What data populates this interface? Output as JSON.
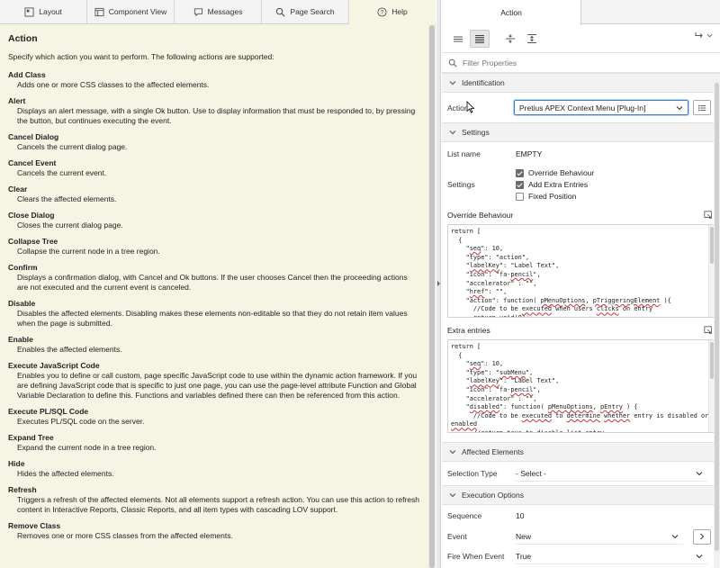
{
  "left_tabs": [
    {
      "label": "Layout",
      "icon": "layout-icon"
    },
    {
      "label": "Component View",
      "icon": "component-view-icon"
    },
    {
      "label": "Messages",
      "icon": "messages-icon"
    },
    {
      "label": "Page Search",
      "icon": "search-icon"
    },
    {
      "label": "Help",
      "icon": "help-icon"
    }
  ],
  "help": {
    "title": "Action",
    "intro": "Specify which action you want to perform. The following actions are supported:",
    "actions": [
      {
        "title": "Add Class",
        "desc": "Adds one or more CSS classes to the affected elements."
      },
      {
        "title": "Alert",
        "desc": "Displays an alert message, with a single Ok button. Use to display information that must be responded to, by pressing the button, but continues executing the event."
      },
      {
        "title": "Cancel Dialog",
        "desc": "Cancels the current dialog page."
      },
      {
        "title": "Cancel Event",
        "desc": "Cancels the current event."
      },
      {
        "title": "Clear",
        "desc": "Clears the affected elements."
      },
      {
        "title": "Close Dialog",
        "desc": "Closes the current dialog page."
      },
      {
        "title": "Collapse Tree",
        "desc": "Collapse the current node in a tree region."
      },
      {
        "title": "Confirm",
        "desc": "Displays a confirmation dialog, with Cancel and Ok buttons. If the user chooses Cancel then the proceeding actions are not executed and the current event is canceled."
      },
      {
        "title": "Disable",
        "desc": "Disables the affected elements. Disabling makes these elements non-editable so that they do not retain item values when the page is submitted."
      },
      {
        "title": "Enable",
        "desc": "Enables the affected elements."
      },
      {
        "title": "Execute JavaScript Code",
        "desc": "Enables you to define or call custom, page specific JavaScript code to use within the dynamic action framework. If you are defining JavaScript code that is specific to just one page, you can use the page-level attribute Function and Global Variable Declaration to define this. Functions and variables defined there can then be referenced from this action."
      },
      {
        "title": "Execute PL/SQL Code",
        "desc": "Executes PL/SQL code on the server."
      },
      {
        "title": "Expand Tree",
        "desc": "Expand the current node in a tree region."
      },
      {
        "title": "Hide",
        "desc": "Hides the affected elements."
      },
      {
        "title": "Refresh",
        "desc": "Triggers a refresh of the affected elements. Not all elements support a refresh action. You can use this action to refresh content in Interactive Reports, Classic Reports, and all item types with cascading LOV support."
      },
      {
        "title": "Remove Class",
        "desc": "Removes one or more CSS classes from the affected elements."
      }
    ]
  },
  "right": {
    "tab_label": "Action",
    "filter_placeholder": "Filter Properties",
    "groups": {
      "identification": "Identification",
      "settings": "Settings",
      "affected": "Affected Elements",
      "execution": "Execution Options"
    },
    "action_label": "Action",
    "action_value": "Pretius APEX Context Menu [Plug-In]",
    "list_name_label": "List name",
    "list_name_value": "EMPTY",
    "settings_label": "Settings",
    "checkboxes": [
      {
        "label": "Override Behaviour",
        "checked": true
      },
      {
        "label": "Add Extra Entries",
        "checked": true
      },
      {
        "label": "Fixed Position",
        "checked": false
      }
    ],
    "override_label": "Override Behaviour",
    "extra_label": "Extra entries",
    "selection_type_label": "Selection Type",
    "selection_type_value": "- Select -",
    "sequence_label": "Sequence",
    "sequence_value": "10",
    "event_label": "Event",
    "event_value": "New",
    "fire_label": "Fire When Event",
    "fire_value": "True"
  }
}
